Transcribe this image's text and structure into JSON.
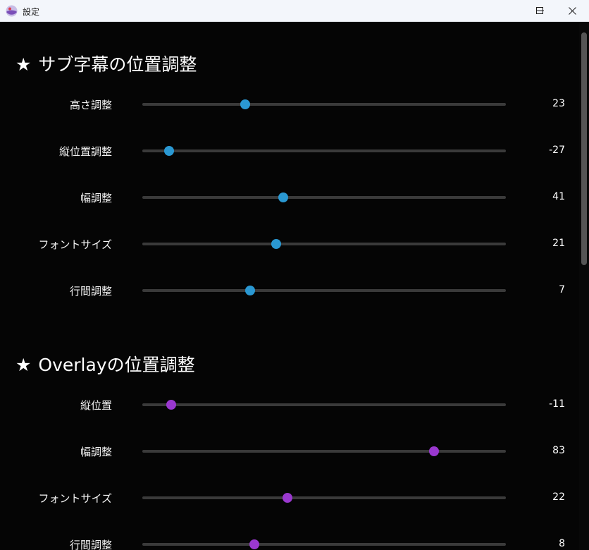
{
  "window": {
    "title": "設定",
    "controls": {
      "minimize": "minimize-icon",
      "maximize": "maximize-icon",
      "close": "close-icon"
    }
  },
  "accent_colors": {
    "subtitle": "#2a98d2",
    "overlay": "#9a38cf"
  },
  "sections": [
    {
      "star": "★",
      "title": "サブ字幕の位置調整",
      "rows": [
        {
          "label": "高さ調整",
          "value": "23",
          "position": 0.282
        },
        {
          "label": "縦位置調整",
          "value": "-27",
          "position": 0.074
        },
        {
          "label": "幅調整",
          "value": "41",
          "position": 0.388
        },
        {
          "label": "フォントサイズ",
          "value": "21",
          "position": 0.368
        },
        {
          "label": "行間調整",
          "value": "7",
          "position": 0.297
        }
      ]
    },
    {
      "star": "★",
      "title": "Overlayの位置調整",
      "rows": [
        {
          "label": "縦位置",
          "value": "-11",
          "position": 0.08
        },
        {
          "label": "幅調整",
          "value": "83",
          "position": 0.802
        },
        {
          "label": "フォントサイズ",
          "value": "22",
          "position": 0.4
        },
        {
          "label": "行間調整",
          "value": "8",
          "position": 0.308
        }
      ]
    }
  ]
}
